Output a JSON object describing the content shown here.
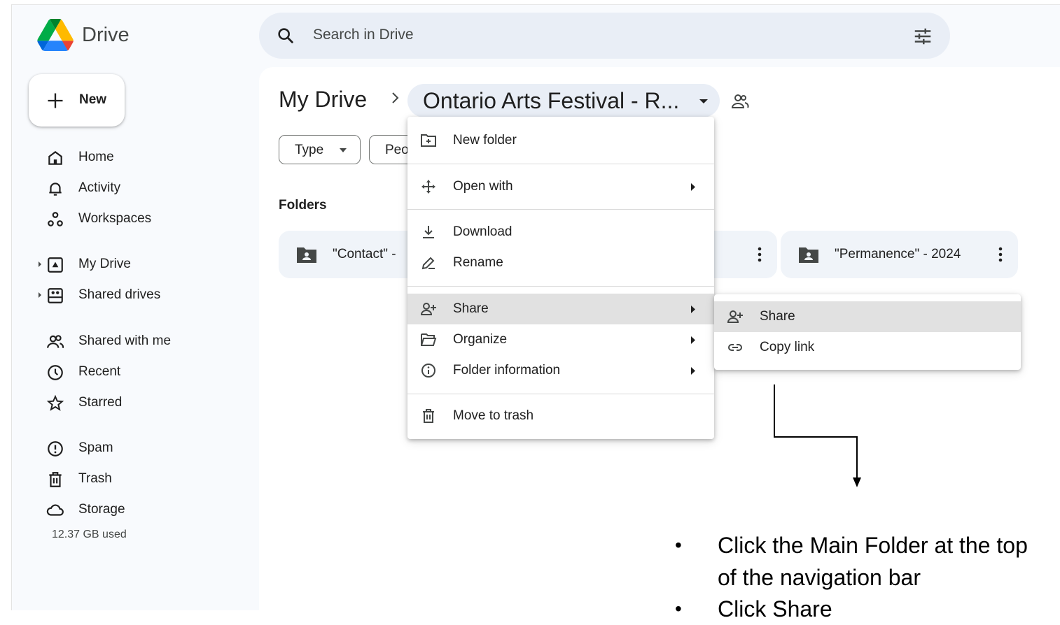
{
  "app": {
    "name": "Drive"
  },
  "search": {
    "placeholder": "Search in Drive"
  },
  "sidebar": {
    "new_label": "New",
    "items": [
      {
        "label": "Home",
        "icon": "home-icon"
      },
      {
        "label": "Activity",
        "icon": "bell-icon"
      },
      {
        "label": "Workspaces",
        "icon": "workspaces-icon"
      },
      {
        "label": "My Drive",
        "icon": "my-drive-icon"
      },
      {
        "label": "Shared drives",
        "icon": "shared-drives-icon"
      },
      {
        "label": "Shared with me",
        "icon": "people-icon"
      },
      {
        "label": "Recent",
        "icon": "clock-icon"
      },
      {
        "label": "Starred",
        "icon": "star-icon"
      },
      {
        "label": "Spam",
        "icon": "spam-icon"
      },
      {
        "label": "Trash",
        "icon": "trash-icon"
      },
      {
        "label": "Storage",
        "icon": "cloud-icon"
      }
    ],
    "storage_used": "12.37 GB used"
  },
  "breadcrumb": {
    "root": "My Drive",
    "current": "Ontario Arts Festival - R..."
  },
  "filters": {
    "type": "Type",
    "people": "Peo"
  },
  "folders": {
    "heading": "Folders",
    "items": [
      {
        "name": "\"Contact\" -"
      },
      {
        "name": "."
      },
      {
        "name": "\"Permanence\" - 2024"
      }
    ]
  },
  "context_menu": {
    "items": [
      {
        "label": "New folder",
        "icon": "new-folder-icon"
      },
      {
        "label": "Open with",
        "icon": "open-with-icon"
      },
      {
        "label": "Download",
        "icon": "download-icon"
      },
      {
        "label": "Rename",
        "icon": "rename-icon"
      },
      {
        "label": "Share",
        "icon": "share-person-icon"
      },
      {
        "label": "Organize",
        "icon": "folder-open-icon"
      },
      {
        "label": "Folder information",
        "icon": "info-icon"
      },
      {
        "label": "Move to trash",
        "icon": "trash-icon"
      }
    ]
  },
  "share_submenu": {
    "items": [
      {
        "label": "Share",
        "icon": "share-person-icon"
      },
      {
        "label": "Copy link",
        "icon": "link-icon"
      }
    ]
  },
  "instructions": [
    "Click the Main Folder at the top of the navigation bar",
    "Click Share"
  ],
  "colors": {
    "app_bg": "#f8fafd",
    "search_bg": "#e9eef6",
    "highlight": "#e1e1e1",
    "drive_green": "#0f9d58",
    "drive_yellow": "#f4b400",
    "drive_blue": "#4285f4"
  }
}
